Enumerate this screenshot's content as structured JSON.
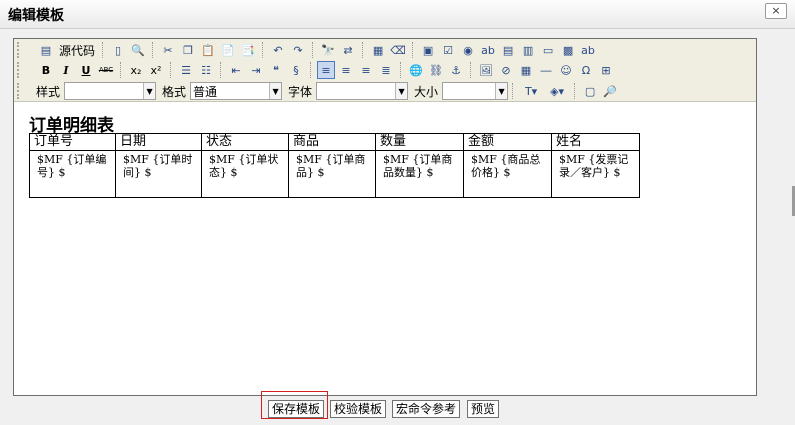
{
  "window": {
    "title": "编辑模板",
    "close_label": "×"
  },
  "toolbar": {
    "source_label": "源代码",
    "style_label": "样式",
    "style_value": "",
    "format_label": "格式",
    "format_value": "普通",
    "font_label": "字体",
    "font_value": "",
    "size_label": "大小",
    "size_value": "",
    "bold": "B",
    "italic": "I",
    "underline": "U",
    "strike": "ABC",
    "subscript": "x₂",
    "superscript": "x²"
  },
  "document": {
    "title": "订单明细表",
    "columns": [
      "订单号",
      "日期",
      "状态",
      "商品",
      "数量",
      "金额",
      "姓名"
    ],
    "cells": [
      "$MF {订单编号} $",
      "$MF {订单时间} $",
      "$MF {订单状态} $",
      "$MF {订单商品} $",
      "$MF {订单商品数量} $",
      "$MF {商品总价格} $",
      "$MF {发票记录／客户} $"
    ]
  },
  "footer": {
    "save": "保存模板",
    "validate": "校验模板",
    "macro_ref": "宏命令参考",
    "preview": "预览"
  },
  "colors": {
    "highlight": "#d02020",
    "toolbar_bg": "#efeee0",
    "active_button": "#c9d8ef"
  }
}
